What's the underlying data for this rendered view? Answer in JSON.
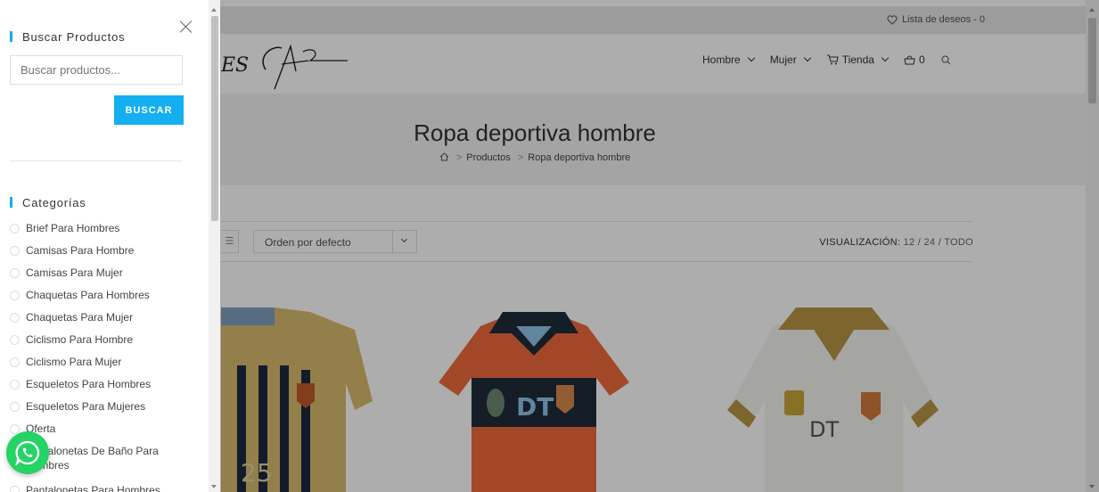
{
  "header": {
    "wishlist_label": "Lista de deseos - 0",
    "logo_text": "ES",
    "nav": [
      {
        "label": "Hombre"
      },
      {
        "label": "Mujer"
      },
      {
        "label": "Tienda"
      }
    ],
    "cart_count": "0"
  },
  "hero": {
    "title": "Ropa deportiva hombre",
    "breadcrumbs": [
      "Productos",
      "Ropa deportiva hombre"
    ]
  },
  "toolbar": {
    "sort_value": "Orden por defecto",
    "view_label": "VISUALIZACIÓN:",
    "view_options": "12 / 24 / TODO"
  },
  "products": [
    {
      "name": "Camiseta a rayas dorado y azul",
      "print": "25",
      "color": "#d7b86a"
    },
    {
      "name": "Camiseta naranja DT",
      "print": "DT",
      "color": "#ef6a3c"
    },
    {
      "name": "Camiseta blanca DT",
      "print": "DT",
      "color": "#f5f5f2"
    }
  ],
  "sidebar": {
    "search_title": "Buscar Productos",
    "search_placeholder": "Buscar productos...",
    "search_button": "BUSCAR",
    "categories_title": "Categorías",
    "categories": [
      "Brief Para Hombres",
      "Camisas Para Hombre",
      "Camisas Para Mujer",
      "Chaquetas Para Hombres",
      "Chaquetas Para Mujer",
      "Ciclismo Para Hombre",
      "Ciclismo Para Mujer",
      "Esqueletos Para Hombres",
      "Esqueletos Para Mujeres",
      "Oferta",
      "Pantalonetas De Baño Para Hombres",
      "Pantalonetas Para Hombres"
    ]
  },
  "colors": {
    "accent": "#13aff0",
    "whatsapp": "#25d366"
  }
}
